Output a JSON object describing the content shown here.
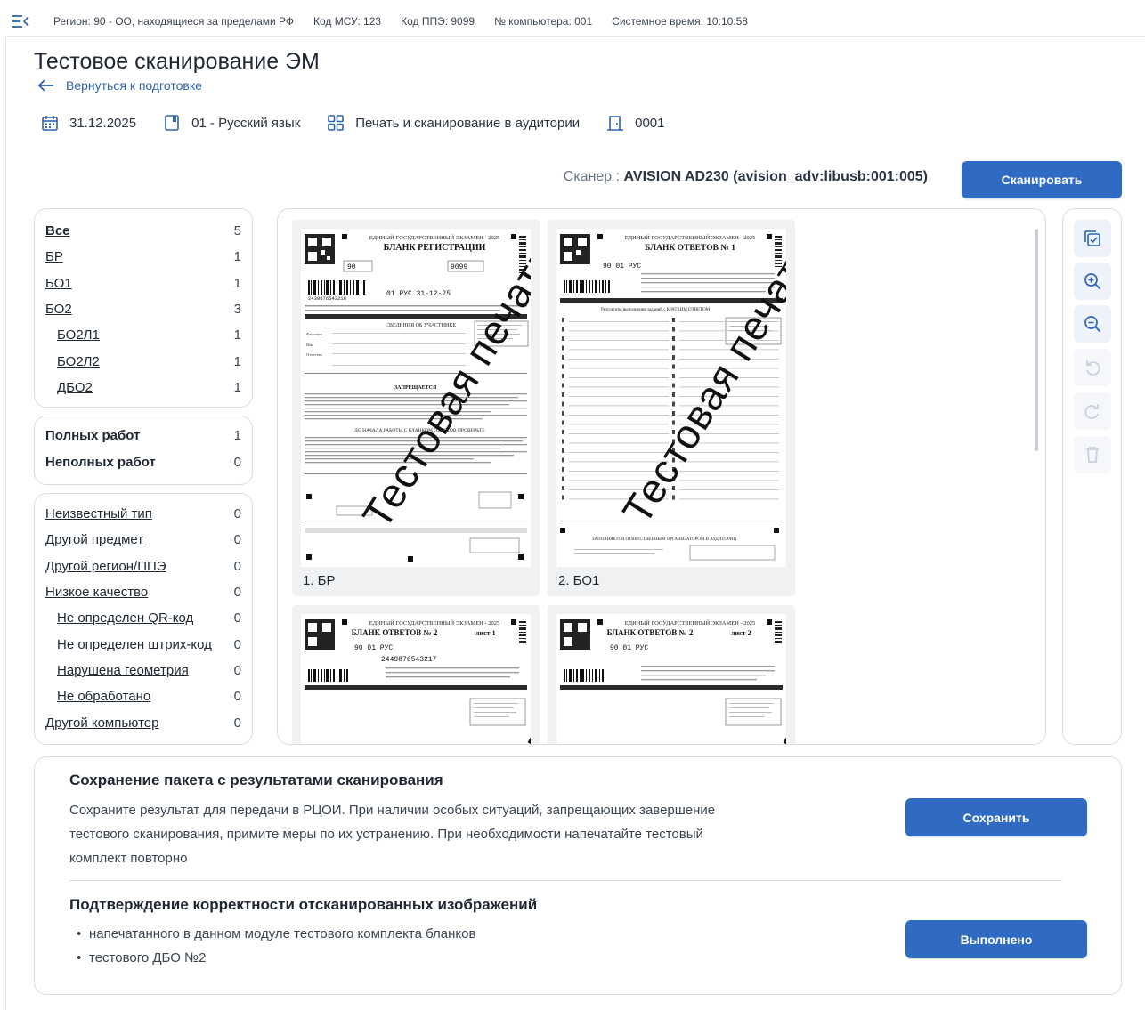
{
  "header": {
    "region": "Регион: 90 - ОО, находящиеся за пределами РФ",
    "msu": "Код МСУ: 123",
    "ppe": "Код ППЭ: 9099",
    "computer": "№ компьютера: 001",
    "time": "Системное время: 10:10:58"
  },
  "page": {
    "title": "Тестовое сканирование ЭМ",
    "back_label": "Вернуться к подготовке"
  },
  "info": {
    "date": "31.12.2025",
    "subject": "01 - Русский язык",
    "mode": "Печать и сканирование в аудитории",
    "room": "0001"
  },
  "scanner": {
    "label": "Сканер :",
    "name": "AVISION AD230 (avision_adv:libusb:001:005)",
    "scan_button": "Сканировать"
  },
  "filters": [
    {
      "label": "Все",
      "count": "5"
    },
    {
      "label": "БР",
      "count": "1"
    },
    {
      "label": "БО1",
      "count": "1"
    },
    {
      "label": "БО2",
      "count": "3"
    },
    {
      "label": "БО2Л1",
      "count": "1"
    },
    {
      "label": "БО2Л2",
      "count": "1"
    },
    {
      "label": "ДБО2",
      "count": "1"
    }
  ],
  "stats": [
    {
      "label": "Полных работ",
      "count": "1"
    },
    {
      "label": "Неполных работ",
      "count": "0"
    }
  ],
  "issues": [
    {
      "label": "Неизвестный тип",
      "count": "0"
    },
    {
      "label": "Другой предмет",
      "count": "0"
    },
    {
      "label": "Другой регион/ППЭ",
      "count": "0"
    },
    {
      "label": "Низкое качество",
      "count": "0"
    },
    {
      "label": "Не определен QR-код",
      "count": "0"
    },
    {
      "label": "Не определен штрих-код",
      "count": "0"
    },
    {
      "label": "Нарушена геометрия",
      "count": "0"
    },
    {
      "label": "Не обработано",
      "count": "0"
    },
    {
      "label": "Другой компьютер",
      "count": "0"
    }
  ],
  "gallery": {
    "watermark": "Тестовая печать",
    "cards": [
      {
        "caption": "1. БР",
        "form_title": "БЛАНК РЕГИСТРАЦИИ",
        "exam": "ЕДИНЫЙ ГОСУДАРСТВЕННЫЙ ЭКЗАМЕН - 2025",
        "codes": "90",
        "extra": "9099",
        "barcode": "2439876543218",
        "subject_code": "01 РУС 31-12-25",
        "sub_heading": "СВЕДЕНИЯ ОБ УЧАСТНИКЕ",
        "fields": [
          "Фамилия",
          "Имя",
          "Отчество"
        ],
        "warn": "ЗАПРЕЩАЕТСЯ",
        "rule": "ДО НАЧАЛА РАБОТЫ С БЛАНКОМ ОТВЕТОВ ПРОВЕРЬТЕ"
      },
      {
        "caption": "2. БО1",
        "form_title": "БЛАНК ОТВЕТОВ № 1",
        "exam": "ЕДИНЫЙ ГОСУДАРСТВЕННЫЙ ЭКЗАМЕН - 2025",
        "codes": "90 01 РУС",
        "sub_heading": "Результаты выполнения заданий с КРАТКИМ ОТВЕТОМ",
        "footer": "ЗАПОЛНЯЕТСЯ ОТВЕТСТВЕННЫМ ОРГАНИЗАТОРОМ В АУДИТОРИИ"
      },
      {
        "caption": "",
        "form_title": "БЛАНК ОТВЕТОВ № 2",
        "sheet": "лист 1",
        "exam": "ЕДИНЫЙ ГОСУДАРСТВЕННЫЙ ЭКЗАМЕН - 2025",
        "codes": "90 01 РУС",
        "barcode": "2449876543217"
      },
      {
        "caption": "",
        "form_title": "БЛАНК ОТВЕТОВ № 2",
        "sheet": "лист 2",
        "exam": "ЕДИНЫЙ ГОСУДАРСТВЕННЫЙ ЭКЗАМЕН - 2025",
        "codes": "90 01 РУС"
      }
    ]
  },
  "tools": [
    "check-all-icon",
    "zoom-in-icon",
    "zoom-out-icon",
    "rotate-left-icon",
    "rotate-right-icon",
    "delete-icon"
  ],
  "save_section": {
    "title": "Сохранение пакета с результатами сканирования",
    "text_line1": "Сохраните результат для передачи в РЦОИ. При наличии особых ситуаций, запрещающих завершение",
    "text_line2": "тестового сканирования, примите меры по их устранению. При необходимости напечатайте тестовый",
    "text_line3": "комплект повторно",
    "button": "Сохранить"
  },
  "confirm_section": {
    "title": "Подтверждение корректности отсканированных изображений",
    "items": [
      "напечатанного в данном модуле тестового комплекта бланков",
      "тестового ДБО №2"
    ],
    "button": "Выполнено"
  },
  "colors": {
    "accent": "#2f6bc2",
    "link": "#2e64b0",
    "border": "#d8dde4"
  }
}
